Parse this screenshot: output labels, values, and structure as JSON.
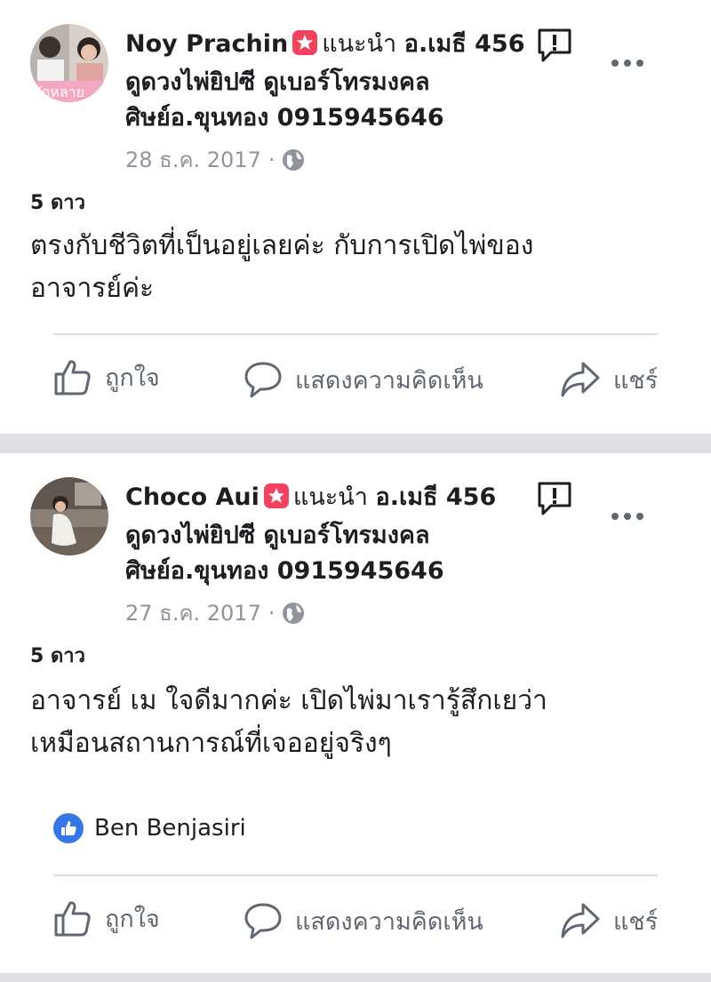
{
  "posts": [
    {
      "author": "Noy Prachin",
      "recommends": "แนะนำ",
      "page_name_1": "อ.เมธี 456",
      "page_name_2": "ดูดวงไพ่ยิปซี ดูเบอร์โทรมงคล",
      "page_name_3": "ศิษย์อ.ขุนทอง 0915945646",
      "date": "28 ธ.ค. 2017",
      "separator": "·",
      "rating": "5 ดาว",
      "text_line_1": "ตรงกับชีวิตที่เป็นอยู่เลยค่ะ กับการเปิดไพ่ของ",
      "text_line_2": "อาจารย์ค่ะ",
      "like_label": "ถูกใจ",
      "comment_label": "แสดงความคิดเห็น",
      "share_label": "แชร์"
    },
    {
      "author": "Choco Aui",
      "recommends": "แนะนำ",
      "page_name_1": "อ.เมธี 456",
      "page_name_2": "ดูดวงไพ่ยิปซี ดูเบอร์โทรมงคล",
      "page_name_3": "ศิษย์อ.ขุนทอง 0915945646",
      "date": "27 ธ.ค. 2017",
      "separator": "·",
      "rating": "5 ดาว",
      "text_line_1": "อาจารย์ เม ใจดีมากค่ะ เปิดไพ่มาเรารู้สึกเยว่า",
      "text_line_2": "เหมือนสถานการณ์ที่เจออยู่จริงๆ",
      "liked_by": "Ben Benjasiri",
      "like_label": "ถูกใจ",
      "comment_label": "แสดงความคิดเห็น",
      "share_label": "แชร์"
    }
  ],
  "colors": {
    "background": "#dddfe2",
    "card": "#ffffff",
    "secondary_text": "#90949c",
    "action_text": "#606770",
    "badge_red": "#f3425f",
    "like_blue": "#3578e5"
  },
  "icons": [
    "recommendation-star-icon",
    "report-icon",
    "more-options-icon",
    "globe-icon",
    "like-thumb-icon",
    "comment-bubble-icon",
    "share-arrow-icon",
    "like-reaction-badge-icon"
  ]
}
